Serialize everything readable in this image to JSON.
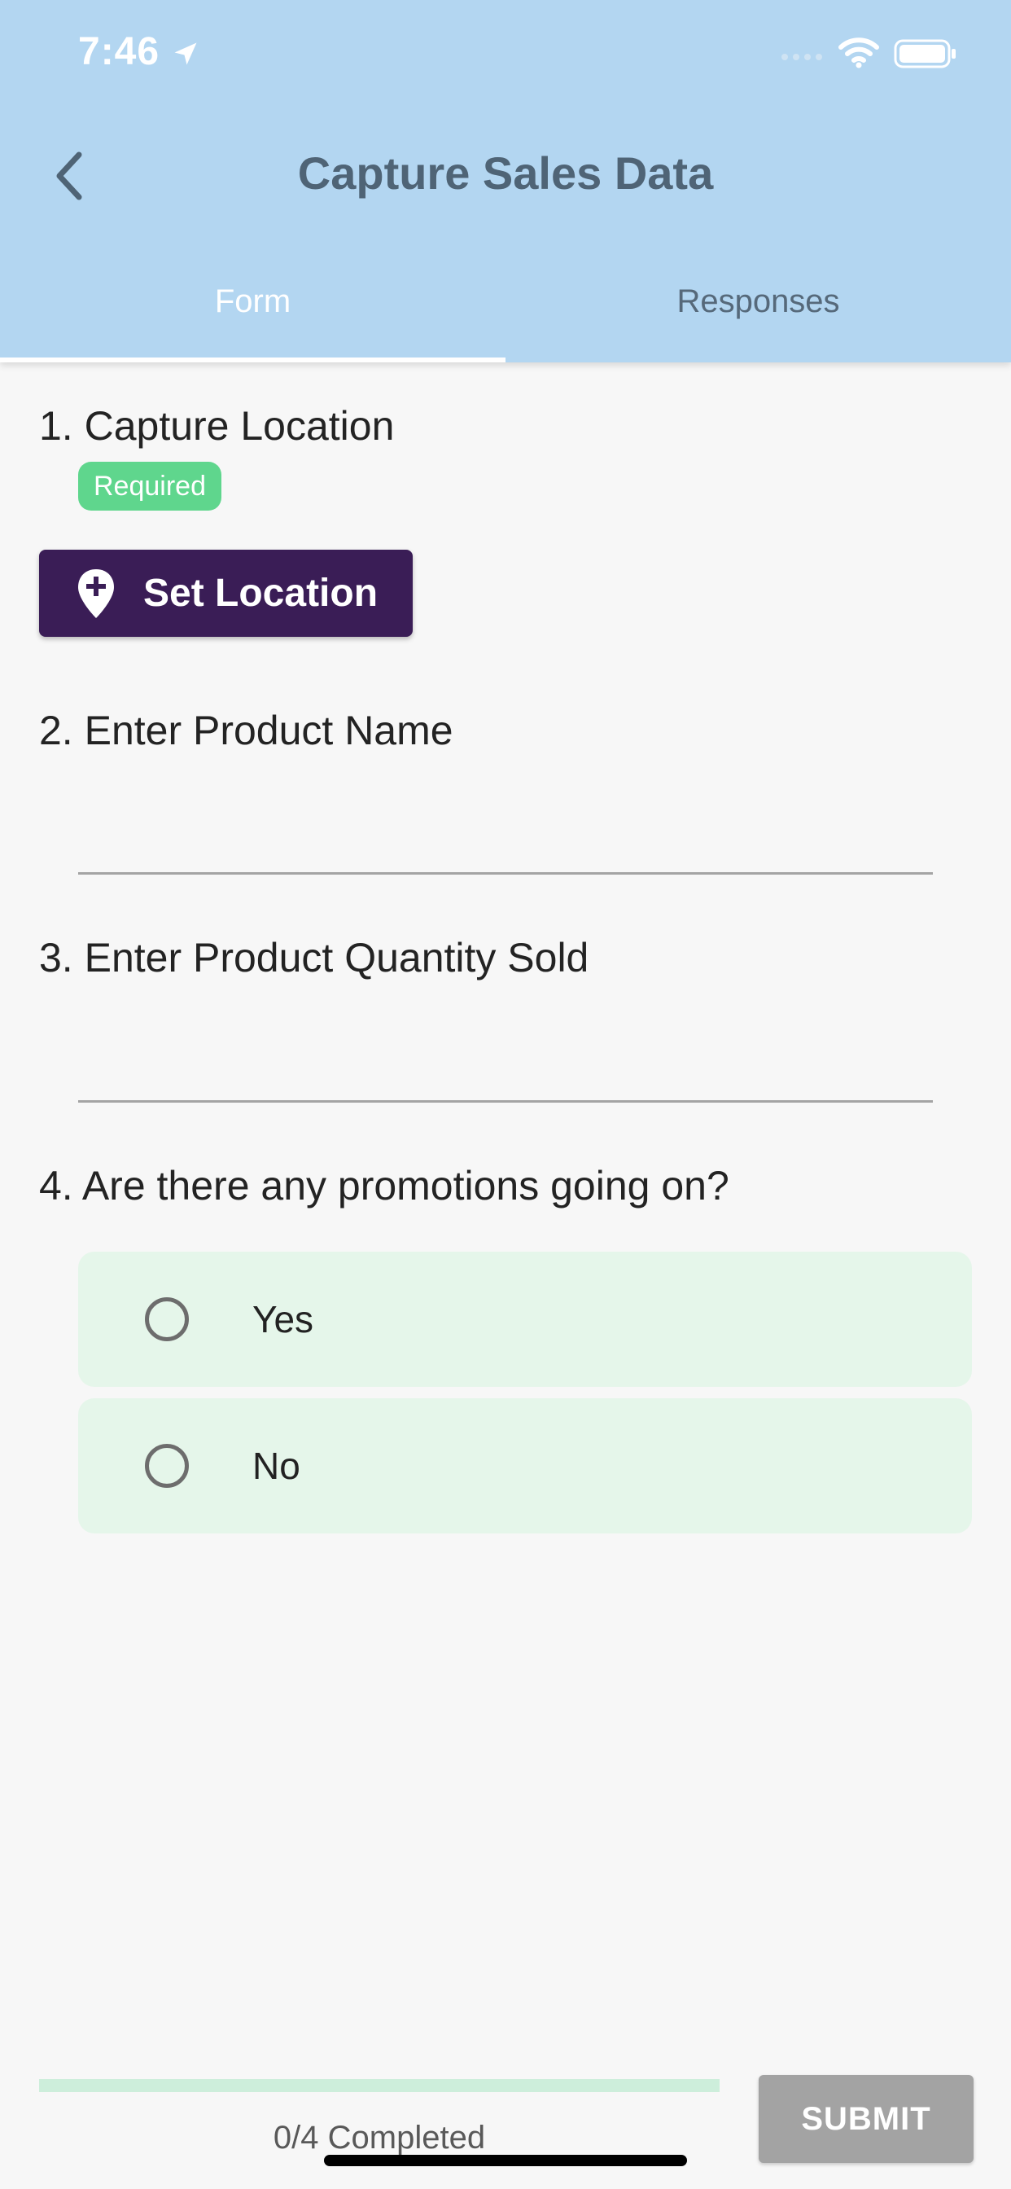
{
  "status_bar": {
    "time": "7:46",
    "location_icon": "location-arrow-icon",
    "signal_icon": "cellular-signal-icon",
    "wifi_icon": "wifi-icon",
    "battery_icon": "battery-icon"
  },
  "header": {
    "title": "Capture Sales Data",
    "back_icon": "chevron-left-icon",
    "background_color": "#b3d6f1"
  },
  "tabs": [
    {
      "label": "Form",
      "active": true
    },
    {
      "label": "Responses",
      "active": false
    }
  ],
  "questions": [
    {
      "label": "1. Capture Location",
      "badge": "Required",
      "button_label": "Set Location",
      "button_icon": "map-pin-plus-icon"
    },
    {
      "label": "2. Enter Product Name",
      "value": ""
    },
    {
      "label": "3. Enter Product Quantity Sold",
      "value": ""
    },
    {
      "label": "4. Are there any promotions going on?",
      "options": [
        {
          "label": "Yes",
          "selected": false
        },
        {
          "label": "No",
          "selected": false
        }
      ]
    }
  ],
  "footer": {
    "progress_text": "0/4 Completed",
    "progress_fraction": 0,
    "submit_label": "SUBMIT"
  },
  "colors": {
    "accent_button": "#3a1d56",
    "required_badge": "#5fd68d",
    "option_background": "#e5f6ea",
    "submit_disabled": "#a3a3a3"
  }
}
